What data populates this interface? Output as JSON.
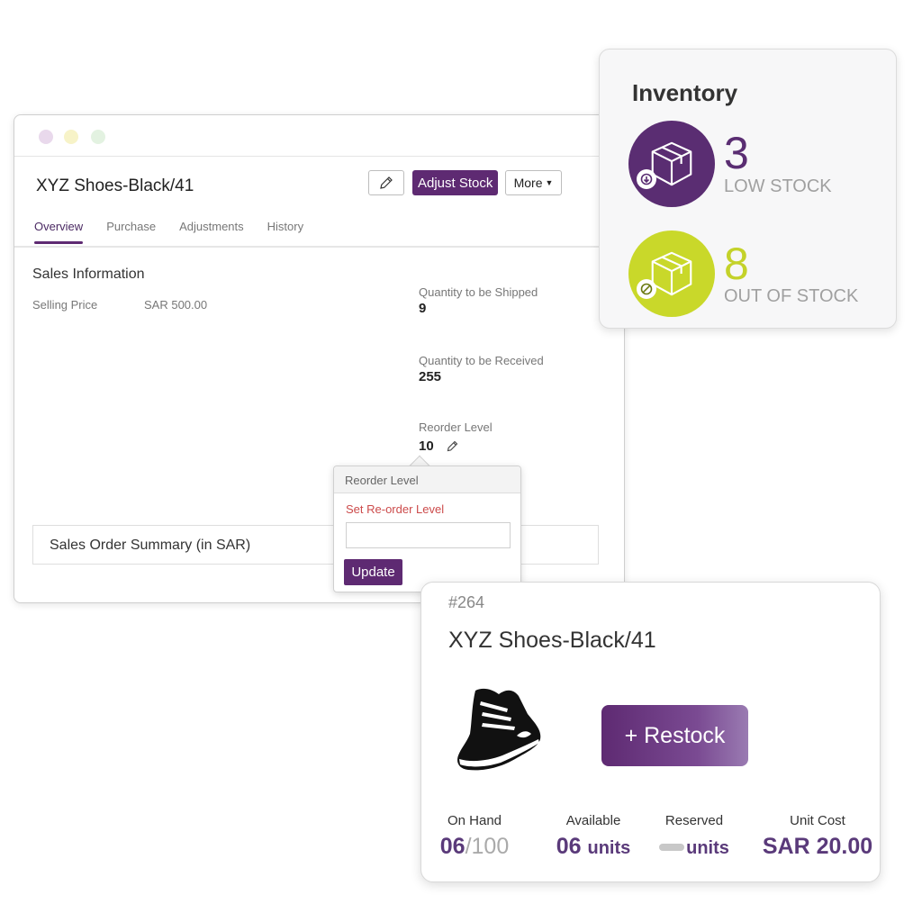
{
  "window": {
    "product_title": "XYZ Shoes-Black/41",
    "buttons": {
      "edit_icon": "pencil-icon",
      "adjust_stock": "Adjust Stock",
      "more": "More"
    },
    "tabs": [
      {
        "label": "Overview",
        "active": true
      },
      {
        "label": "Purchase",
        "active": false
      },
      {
        "label": "Adjustments",
        "active": false
      },
      {
        "label": "History",
        "active": false
      }
    ],
    "sales_info": {
      "title": "Sales Information",
      "selling_price_label": "Selling Price",
      "selling_price_value": "SAR 500.00"
    },
    "stats": {
      "to_ship_label": "Quantity to be Shipped",
      "to_ship_value": "9",
      "to_receive_label": "Quantity to be Received",
      "to_receive_value": "255",
      "reorder_label": "Reorder Level",
      "reorder_value": "10"
    },
    "sales_order_summary": "Sales Order Summary (in SAR)"
  },
  "reorder_popup": {
    "title": "Reorder Level",
    "field_label": "Set Re-order Level",
    "input_value": "",
    "button": "Update"
  },
  "inventory": {
    "title": "Inventory",
    "low_stock": {
      "count": "3",
      "label": "LOW STOCK",
      "color": "#5a2d72"
    },
    "out_of_stock": {
      "count": "8",
      "label": "OUT OF STOCK",
      "color": "#c9d82a"
    }
  },
  "product_card": {
    "id": "#264",
    "title": "XYZ Shoes-Black/41",
    "restock_button": "+ Restock",
    "on_hand": {
      "label": "On Hand",
      "value": "06",
      "total": "/100"
    },
    "available": {
      "label": "Available",
      "value": "06",
      "unit": "units"
    },
    "reserved": {
      "label": "Reserved",
      "unit": "units"
    },
    "unit_cost": {
      "label": "Unit Cost",
      "value": "SAR 20.00"
    },
    "accent": "#5e2a72"
  }
}
